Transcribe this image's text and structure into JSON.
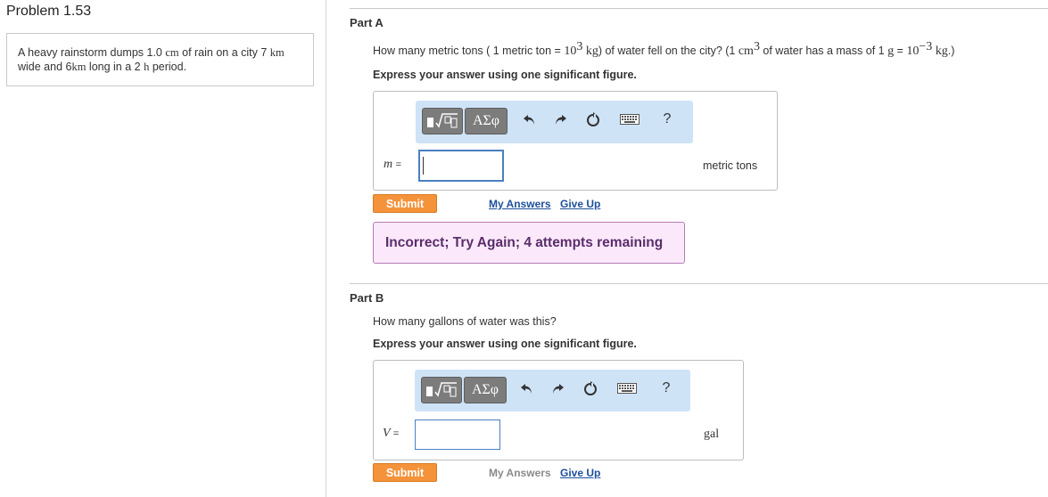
{
  "problem": {
    "title": "Problem 1.53",
    "text_parts": [
      "A heavy rainstorm dumps 1.0 ",
      "cm",
      " of rain on a city 7 ",
      "km",
      " wide and 6",
      "km",
      " long in a 2 ",
      "h",
      " period."
    ]
  },
  "part_a": {
    "label": "Part A",
    "question": {
      "p1": "How many metric tons ( 1 metric ton = ",
      "m1": "10",
      "e1": "3",
      "m2": " kg",
      "p2": ") of water fell on the city? (1 ",
      "m3": "cm",
      "e2": "3",
      "p3": " of water has a mass of 1 ",
      "m4": "g",
      "p4": " = ",
      "m5": "10",
      "e3": "−3",
      "m6": " kg",
      "p5": ".)"
    },
    "instruction": "Express your answer using one significant figure.",
    "toolbar": {
      "greek_label": "ΑΣφ",
      "help_label": "?"
    },
    "variable": "m",
    "equals": "=",
    "input_value": "",
    "units": "metric tons",
    "submit_label": "Submit",
    "my_answers_label": "My Answers",
    "give_up_label": "Give Up",
    "feedback": "Incorrect; Try Again; 4 attempts remaining"
  },
  "part_b": {
    "label": "Part B",
    "question": "How many gallons of water was this?",
    "instruction": "Express your answer using one significant figure.",
    "toolbar": {
      "greek_label": "ΑΣφ",
      "help_label": "?"
    },
    "variable": "V",
    "equals": "=",
    "input_value": "",
    "units": "gal",
    "submit_label": "Submit",
    "my_answers_label": "My Answers",
    "give_up_label": "Give Up"
  },
  "colors": {
    "submit": "#f5933a",
    "toolbar_bg": "#cfe3f7",
    "feedback_bg": "#fbe9fb",
    "feedback_text": "#5a2d6b",
    "link": "#1d4f9c"
  }
}
